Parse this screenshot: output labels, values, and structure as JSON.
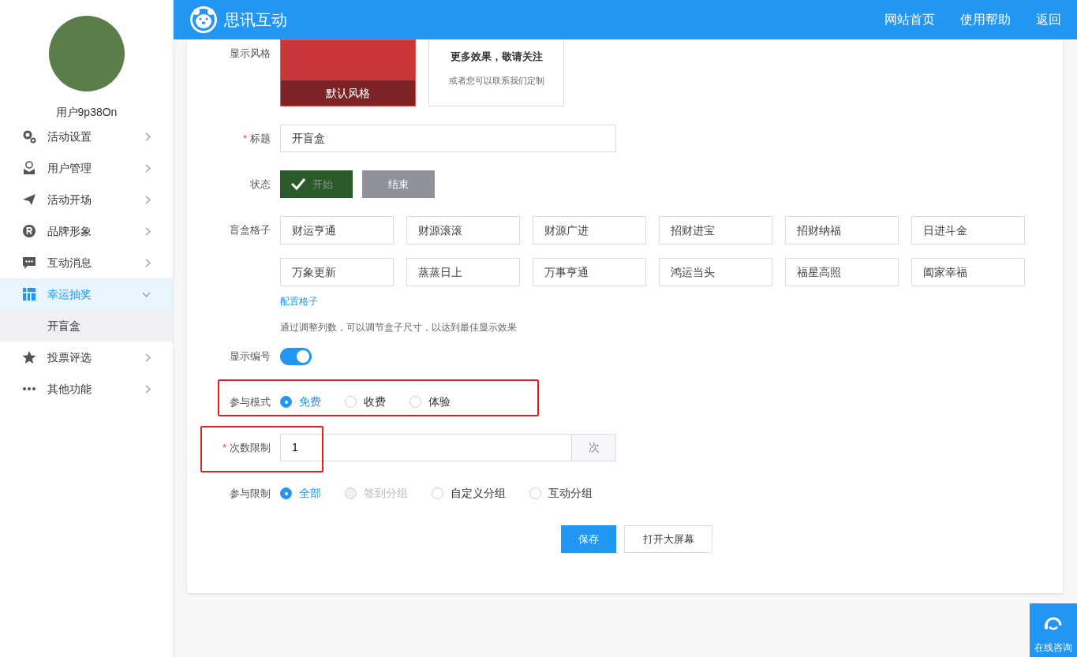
{
  "header": {
    "brand": "思讯互动",
    "links": [
      "网站首页",
      "使用帮助",
      "返回"
    ]
  },
  "sidebar": {
    "user_name": "用户9p38On",
    "items": [
      {
        "label": "活动设置",
        "expanded": false
      },
      {
        "label": "用户管理",
        "expanded": false
      },
      {
        "label": "活动开场",
        "expanded": false
      },
      {
        "label": "品牌形象",
        "expanded": false
      },
      {
        "label": "互动消息",
        "expanded": false
      },
      {
        "label": "幸运抽奖",
        "expanded": true,
        "children": [
          {
            "label": "开盲盒",
            "selected": true
          }
        ]
      },
      {
        "label": "投票评选",
        "expanded": false
      },
      {
        "label": "其他功能",
        "expanded": false
      }
    ]
  },
  "form": {
    "style": {
      "label": "显示风格",
      "options": [
        {
          "kind": "preview",
          "caption": "默认风格"
        },
        {
          "kind": "more",
          "title": "更多效果，敬请关注",
          "subtitle": "或者您可以联系我们定制"
        }
      ]
    },
    "title": {
      "label": "标题",
      "required_mark": "*",
      "value": "开盲盒"
    },
    "status": {
      "label": "状态",
      "options": [
        {
          "label": "开始",
          "selected": true
        },
        {
          "label": "结束",
          "selected": false
        }
      ]
    },
    "grid": {
      "label": "盲盒格子",
      "cells": [
        "财运亨通",
        "财源滚滚",
        "财源广进",
        "招财进宝",
        "招财纳福",
        "日进斗金",
        "万象更新",
        "蒸蒸日上",
        "万事亨通",
        "鸿运当头",
        "福星高照",
        "阖家幸福"
      ],
      "link": "配置格子",
      "hint": "通过调整列数，可以调节盒子尺寸，以达到最佳显示效果"
    },
    "show_number": {
      "label": "显示编号",
      "on": true
    },
    "mode": {
      "label": "参与模式",
      "highlighted": true,
      "options": [
        {
          "label": "免费",
          "selected": true,
          "disabled": false
        },
        {
          "label": "收费",
          "selected": false,
          "disabled": false
        },
        {
          "label": "体验",
          "selected": false,
          "disabled": false
        }
      ]
    },
    "count": {
      "label": "次数限制",
      "required_mark": "*",
      "highlighted": true,
      "value": "1",
      "unit": "次"
    },
    "limit": {
      "label": "参与限制",
      "options": [
        {
          "label": "全部",
          "selected": true,
          "disabled": false
        },
        {
          "label": "签到分组",
          "selected": false,
          "disabled": true
        },
        {
          "label": "自定义分组",
          "selected": false,
          "disabled": false
        },
        {
          "label": "互动分组",
          "selected": false,
          "disabled": false
        }
      ]
    },
    "actions": {
      "save": "保存",
      "open": "打开大屏幕"
    }
  },
  "chat": {
    "label": "在线咨询"
  }
}
